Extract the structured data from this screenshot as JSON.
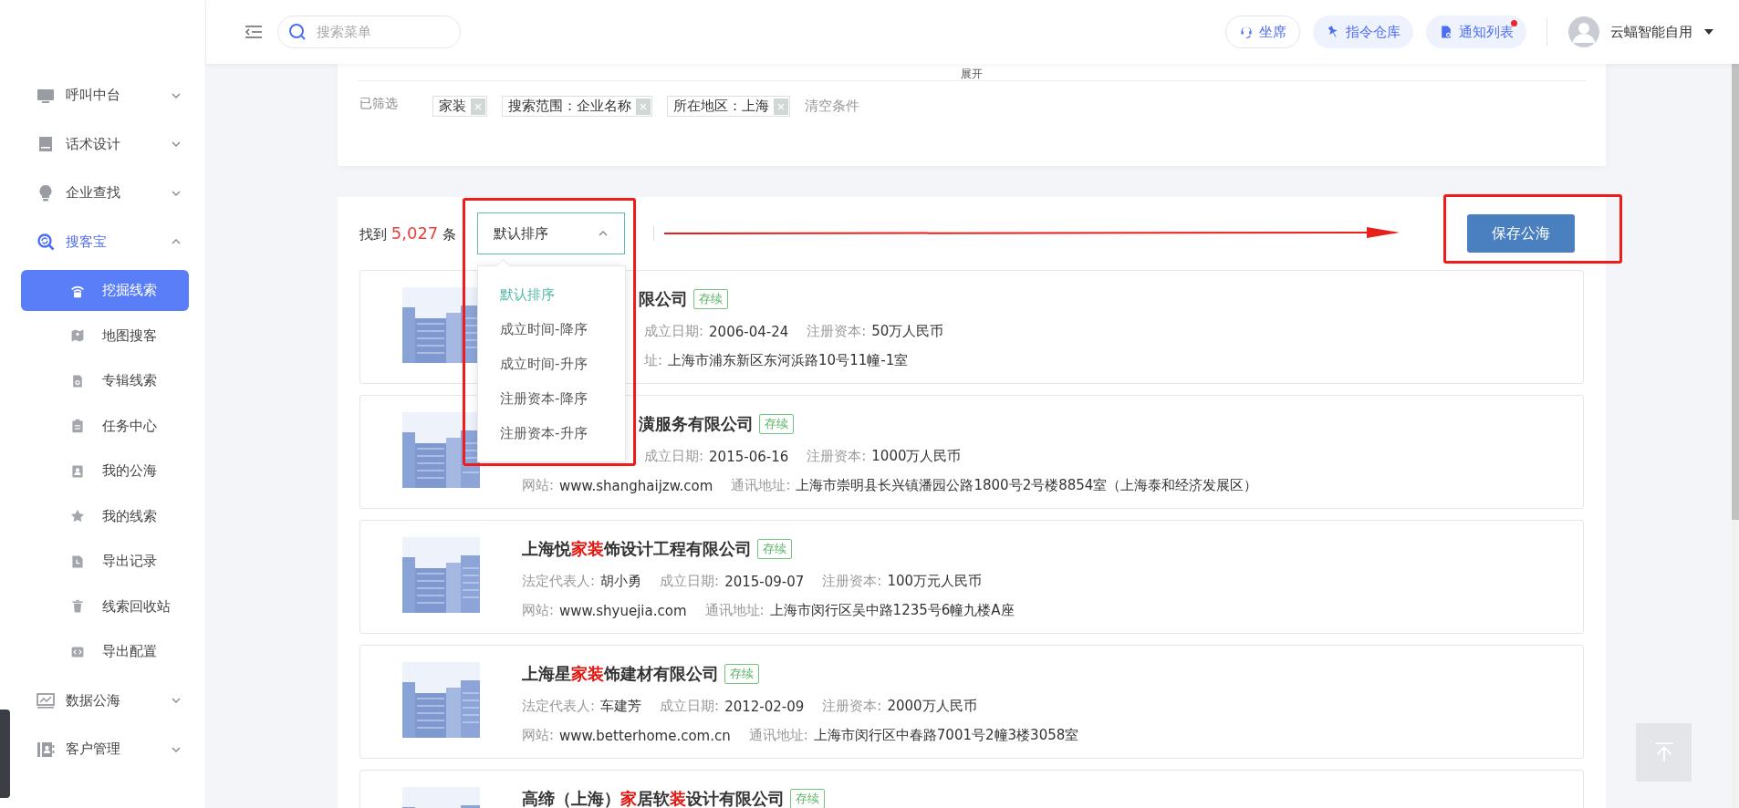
{
  "header": {
    "search": {
      "placeholder": "搜索菜单"
    },
    "buttons": [
      {
        "label": "坐席",
        "badge": false
      },
      {
        "label": "指令仓库",
        "badge": false
      },
      {
        "label": "通知列表",
        "badge": true
      }
    ],
    "user": {
      "name": "云蝠智能自用"
    }
  },
  "sidebar": {
    "items": [
      {
        "label": "呼叫中台",
        "expanded": false
      },
      {
        "label": "话术设计",
        "expanded": false
      },
      {
        "label": "企业查找",
        "expanded": false
      },
      {
        "label": "搜客宝",
        "expanded": true,
        "children": [
          {
            "label": "挖掘线索",
            "selected": true
          },
          {
            "label": "地图搜客",
            "selected": false
          },
          {
            "label": "专辑线索",
            "selected": false
          },
          {
            "label": "任务中心",
            "selected": false
          },
          {
            "label": "我的公海",
            "selected": false
          },
          {
            "label": "我的线索",
            "selected": false
          },
          {
            "label": "导出记录",
            "selected": false
          },
          {
            "label": "线索回收站",
            "selected": false
          },
          {
            "label": "导出配置",
            "selected": false
          }
        ]
      },
      {
        "label": "数据公海",
        "expanded": false
      },
      {
        "label": "客户管理",
        "expanded": false
      }
    ]
  },
  "filters": {
    "expand_label": "展开",
    "label": "已筛选",
    "tags": [
      "家装",
      "搜索范围：企业名称",
      "所在地区：上海"
    ],
    "clear": "清空条件"
  },
  "results": {
    "found_prefix": "找到",
    "count": "5,027",
    "found_suffix": "条",
    "sort": {
      "value": "默认排序",
      "expanded": true,
      "options": [
        {
          "label": "默认排序",
          "selected": true
        },
        {
          "label": "成立时间-降序",
          "selected": false
        },
        {
          "label": "成立时间-升序",
          "selected": false
        },
        {
          "label": "注册资本-降序",
          "selected": false
        },
        {
          "label": "注册资本-升序",
          "selected": false
        }
      ]
    },
    "save_button": "保存公海",
    "companies": [
      {
        "name": [
          {
            "text": "限公司",
            "hit": false
          }
        ],
        "name_covered": true,
        "status": "存续",
        "rows": [
          {
            "covered": true,
            "fields": [
              {
                "label": "成立日期:",
                "value": "2006-04-24"
              },
              {
                "label": "注册资本:",
                "value": "50万人民币"
              }
            ]
          },
          {
            "covered": true,
            "fields": [
              {
                "label": "址:",
                "value": "上海市浦东新区东河浜路10号11幢-1室"
              }
            ]
          }
        ]
      },
      {
        "name": [
          {
            "text": "潢服务有限公司",
            "hit": false
          }
        ],
        "name_covered": true,
        "status": "存续",
        "rows": [
          {
            "covered": true,
            "fields": [
              {
                "label": "成立日期:",
                "value": "2015-06-16"
              },
              {
                "label": "注册资本:",
                "value": "1000万人民币"
              }
            ]
          },
          {
            "covered": false,
            "fields": [
              {
                "label": "网站:",
                "value": "www.shanghaijzw.com"
              },
              {
                "label": "通讯地址:",
                "value": "上海市崇明县长兴镇潘园公路1800号2号楼8854室（上海泰和经济发展区）"
              }
            ]
          }
        ]
      },
      {
        "name": [
          {
            "text": "上海悦",
            "hit": false
          },
          {
            "text": "家装",
            "hit": true
          },
          {
            "text": "饰设计工程有限公司",
            "hit": false
          }
        ],
        "name_covered": false,
        "status": "存续",
        "rows": [
          {
            "covered": false,
            "fields": [
              {
                "label": "法定代表人:",
                "value": "胡小勇"
              },
              {
                "label": "成立日期:",
                "value": "2015-09-07"
              },
              {
                "label": "注册资本:",
                "value": "100万元人民币"
              }
            ]
          },
          {
            "covered": false,
            "fields": [
              {
                "label": "网站:",
                "value": "www.shyuejia.com"
              },
              {
                "label": "通讯地址:",
                "value": "上海市闵行区吴中路1235号6幢九楼A座"
              }
            ]
          }
        ]
      },
      {
        "name": [
          {
            "text": "上海星",
            "hit": false
          },
          {
            "text": "家装",
            "hit": true
          },
          {
            "text": "饰建材有限公司",
            "hit": false
          }
        ],
        "name_covered": false,
        "status": "存续",
        "rows": [
          {
            "covered": false,
            "fields": [
              {
                "label": "法定代表人:",
                "value": "车建芳"
              },
              {
                "label": "成立日期:",
                "value": "2012-02-09"
              },
              {
                "label": "注册资本:",
                "value": "2000万人民币"
              }
            ]
          },
          {
            "covered": false,
            "fields": [
              {
                "label": "网站:",
                "value": "www.betterhome.com.cn"
              },
              {
                "label": "通讯地址:",
                "value": "上海市闵行区中春路7001号2幢3楼3058室"
              }
            ]
          }
        ]
      },
      {
        "name": [
          {
            "text": "高缔（上海）",
            "hit": false
          },
          {
            "text": "家",
            "hit": true
          },
          {
            "text": "居软",
            "hit": false
          },
          {
            "text": "装",
            "hit": true
          },
          {
            "text": "设计有限公司",
            "hit": false
          }
        ],
        "name_covered": false,
        "status": "存续"
      }
    ]
  },
  "annotations": {
    "sort_highlight": true,
    "save_highlight": true,
    "arrow": true
  }
}
